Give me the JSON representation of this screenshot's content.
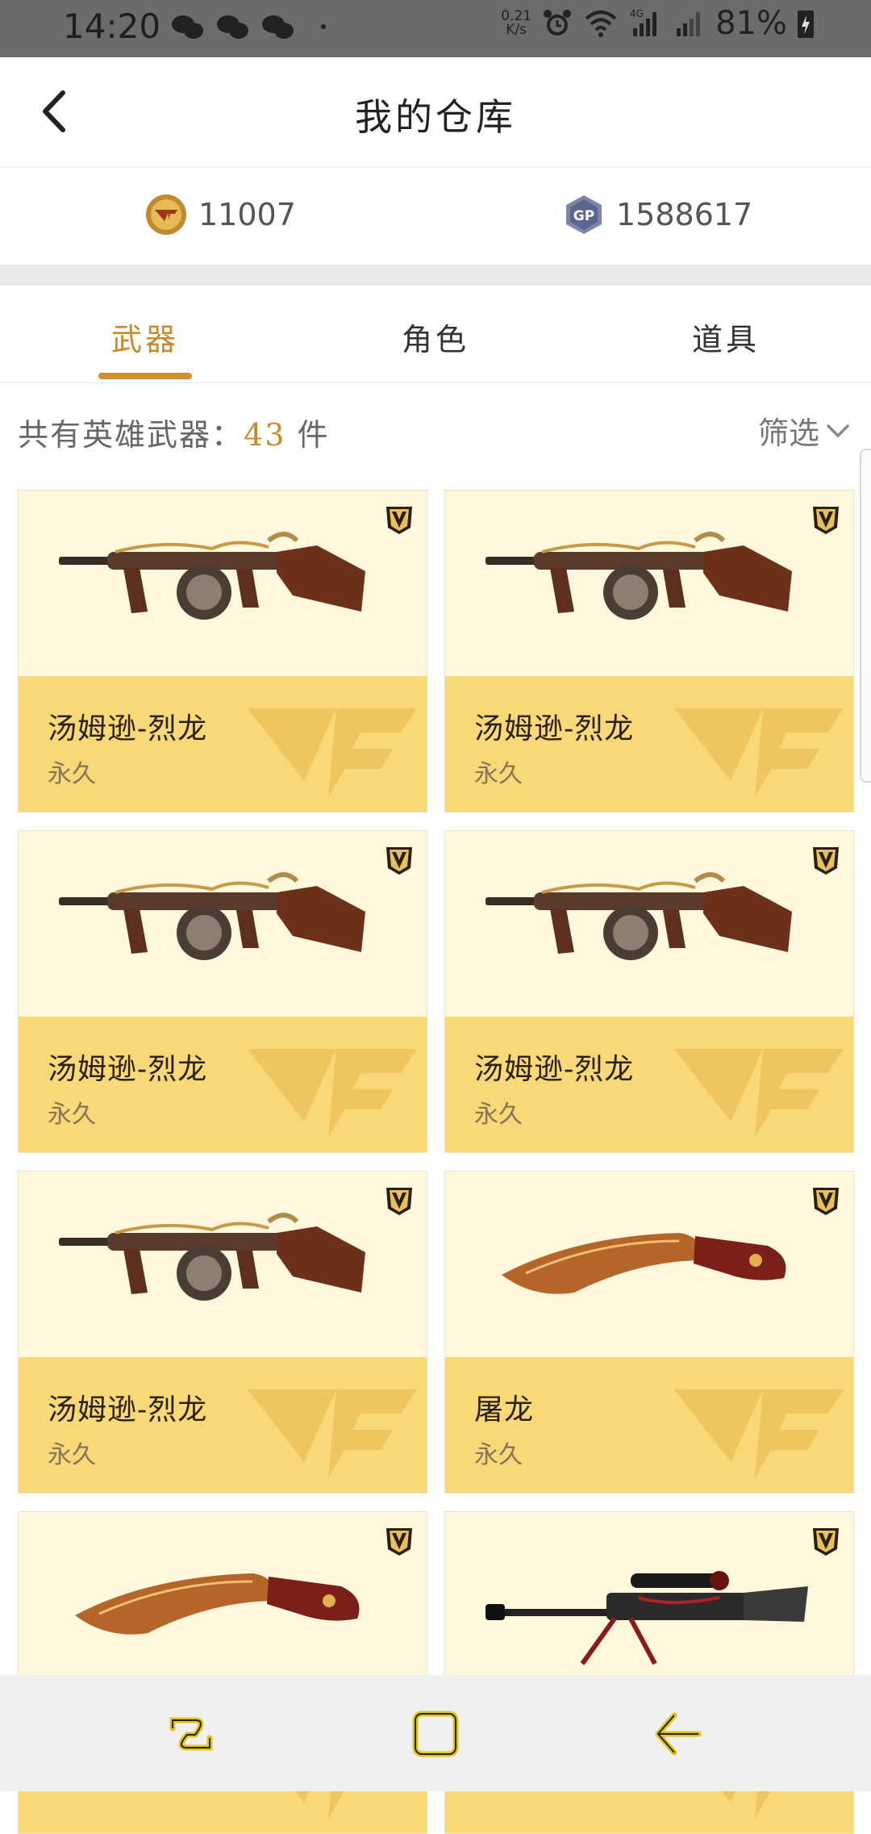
{
  "status_bar": {
    "time": "14:20",
    "net_speed_value": "0.21",
    "net_speed_unit": "K/s",
    "network": "4G",
    "battery": "81%",
    "icons": [
      "wechat-icon",
      "wechat-icon",
      "wechat-icon",
      "alarm-icon",
      "wifi-icon",
      "signal-icon",
      "signal-icon",
      "battery-charging-icon"
    ]
  },
  "header": {
    "title": "我的仓库",
    "back_icon": "chevron-left-icon"
  },
  "currency": {
    "cf_points": "11007",
    "gp_points": "1588617",
    "gp_label": "GP"
  },
  "tabs": [
    {
      "label": "武器",
      "active": true
    },
    {
      "label": "角色",
      "active": false
    },
    {
      "label": "道具",
      "active": false
    }
  ],
  "summary": {
    "prefix": "共有英雄武器：",
    "count": "43",
    "suffix": " 件",
    "filter_label": "筛选"
  },
  "items": [
    {
      "name": "汤姆逊-烈龙",
      "duration": "永久",
      "type": "smg"
    },
    {
      "name": "汤姆逊-烈龙",
      "duration": "永久",
      "type": "smg"
    },
    {
      "name": "汤姆逊-烈龙",
      "duration": "永久",
      "type": "smg"
    },
    {
      "name": "汤姆逊-烈龙",
      "duration": "永久",
      "type": "smg"
    },
    {
      "name": "汤姆逊-烈龙",
      "duration": "永久",
      "type": "smg"
    },
    {
      "name": "屠龙",
      "duration": "永久",
      "type": "knife"
    },
    {
      "name": "",
      "duration": "",
      "type": "knife"
    },
    {
      "name": "",
      "duration": "",
      "type": "sniper"
    }
  ],
  "colors": {
    "accent": "#d38d2b",
    "card_top": "#fff8dc",
    "card_bottom": "#f8d877"
  },
  "nav_bar": [
    "recent-apps-icon",
    "home-icon",
    "back-icon"
  ]
}
